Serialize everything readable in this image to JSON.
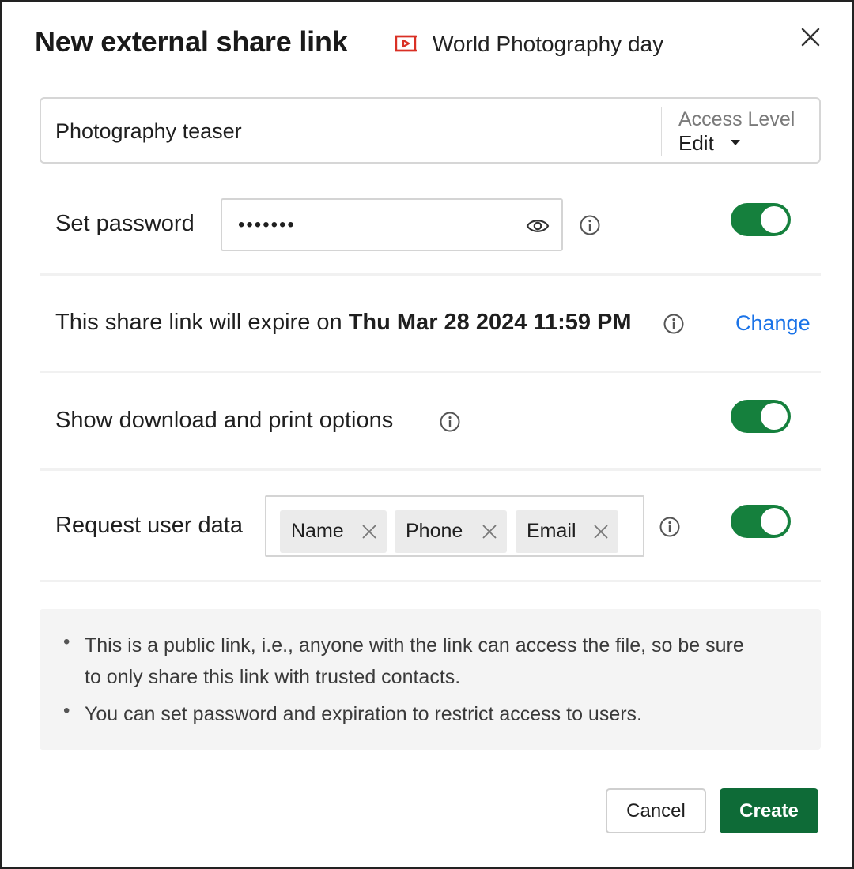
{
  "header": {
    "title": "New external share link",
    "file_name": "World Photography day",
    "file_icon": "presentation-icon",
    "close_icon": "close-icon"
  },
  "link_name": {
    "value": "Photography teaser",
    "access_level_label": "Access Level",
    "access_level_value": "Edit"
  },
  "password": {
    "label": "Set password",
    "value": "•••••••",
    "enabled": true
  },
  "expiry": {
    "prefix": "This share link will expire on ",
    "date": "Thu Mar 28 2024 11:59 PM",
    "change_label": "Change"
  },
  "download": {
    "label": "Show download and print options",
    "enabled": true
  },
  "user_data": {
    "label": "Request user data",
    "chips": [
      "Name",
      "Phone",
      "Email"
    ],
    "enabled": true
  },
  "note": {
    "bullets": [
      "This is a public link, i.e., anyone with the link can access the file, so be sure",
      "to only share this link with trusted contacts.",
      "You can set password and expiration to restrict access to users."
    ]
  },
  "actions": {
    "cancel_label": "Cancel",
    "create_label": "Create"
  },
  "colors": {
    "toggle_on": "#15803d",
    "primary_button": "#0e6b37",
    "link": "#1a73e8",
    "file_icon": "#d93025"
  }
}
